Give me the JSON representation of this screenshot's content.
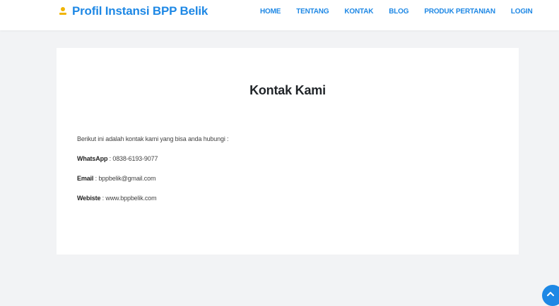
{
  "header": {
    "brand": "Profil Instansi BPP Belik",
    "brand_icon": "person-icon",
    "accent_color": "#1e88e5",
    "nav": [
      {
        "label": "HOME"
      },
      {
        "label": "TENTANG"
      },
      {
        "label": "KONTAK"
      },
      {
        "label": "BLOG"
      },
      {
        "label": "PRODUK PERTANIAN"
      },
      {
        "label": "LOGIN"
      }
    ]
  },
  "main": {
    "title": "Kontak Kami",
    "intro": "Berikut ini adalah kontak kami yang bisa anda hubungi :",
    "contacts": [
      {
        "label": "WhatsApp",
        "value": " : 0838-6193-9077"
      },
      {
        "label": "Email",
        "value": " : bppbelik@gmail.com"
      },
      {
        "label": "Webiste",
        "value": " : www.bppbelik.com"
      }
    ]
  },
  "scroll_top": {
    "icon": "chevron-up-icon"
  }
}
